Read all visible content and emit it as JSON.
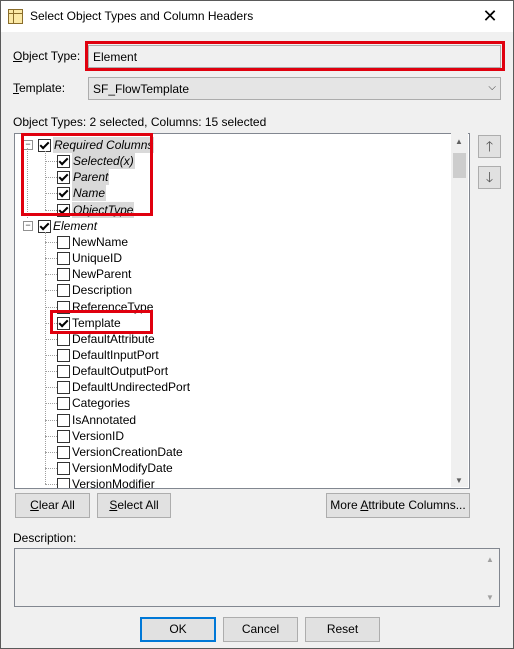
{
  "window": {
    "title": "Select Object Types and Column Headers"
  },
  "object_type": {
    "label": "Object Type:",
    "value": "Element"
  },
  "template": {
    "label": "Template:",
    "value": "SF_FlowTemplate"
  },
  "summary": "Object Types: 2 selected, Columns: 15 selected",
  "tree": {
    "groups": [
      {
        "label": "Required Columns",
        "checked": true,
        "italic": true,
        "items": [
          {
            "label": "Selected(x)",
            "checked": true
          },
          {
            "label": "Parent",
            "checked": true
          },
          {
            "label": "Name",
            "checked": true
          },
          {
            "label": "ObjectType",
            "checked": true
          }
        ]
      },
      {
        "label": "Element",
        "checked": true,
        "italic": true,
        "items": [
          {
            "label": "NewName",
            "checked": false
          },
          {
            "label": "UniqueID",
            "checked": false
          },
          {
            "label": "NewParent",
            "checked": false
          },
          {
            "label": "Description",
            "checked": false
          },
          {
            "label": "ReferenceType",
            "checked": false
          },
          {
            "label": "Template",
            "checked": true
          },
          {
            "label": "DefaultAttribute",
            "checked": false
          },
          {
            "label": "DefaultInputPort",
            "checked": false
          },
          {
            "label": "DefaultOutputPort",
            "checked": false
          },
          {
            "label": "DefaultUndirectedPort",
            "checked": false
          },
          {
            "label": "Categories",
            "checked": false
          },
          {
            "label": "IsAnnotated",
            "checked": false
          },
          {
            "label": "VersionID",
            "checked": false
          },
          {
            "label": "VersionCreationDate",
            "checked": false
          },
          {
            "label": "VersionModifyDate",
            "checked": false
          },
          {
            "label": "VersionModifier",
            "checked": false
          }
        ]
      }
    ]
  },
  "buttons": {
    "clear_all": "Clear All",
    "select_all": "Select All",
    "more_attribute_columns": "More Attribute Columns...",
    "ok": "OK",
    "cancel": "Cancel",
    "reset": "Reset"
  },
  "description": {
    "label": "Description:",
    "value": ""
  },
  "icons": {
    "move_up": "arrow-up-icon",
    "move_down": "arrow-down-icon",
    "close": "close-icon"
  },
  "colors": {
    "highlight": "#e0000e",
    "accent": "#0078d7"
  }
}
